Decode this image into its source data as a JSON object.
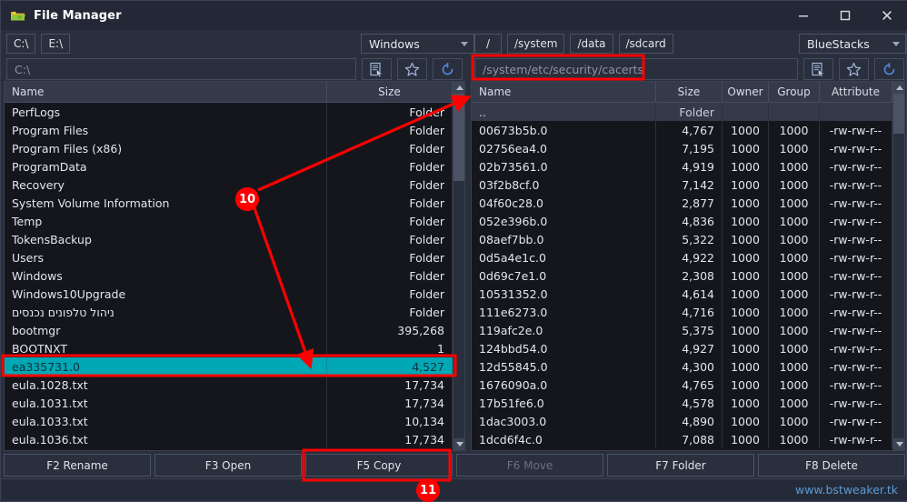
{
  "window": {
    "title": "File Manager",
    "icon": "app-folder-icon",
    "minimize": "–",
    "maximize": "□",
    "close": "×"
  },
  "left_panel": {
    "shortcuts": [
      "C:\\",
      "E:\\"
    ],
    "drive_select": {
      "value": "Windows"
    },
    "path": {
      "value": "C:\\",
      "placeholder": "C:\\"
    },
    "toolbar_icons": [
      "select-list-icon",
      "favorite-star-icon",
      "refresh-icon"
    ],
    "columns": [
      "Name",
      "Size"
    ],
    "rows": [
      {
        "name": "PerfLogs",
        "size": "Folder"
      },
      {
        "name": "Program Files",
        "size": "Folder"
      },
      {
        "name": "Program Files (x86)",
        "size": "Folder"
      },
      {
        "name": "ProgramData",
        "size": "Folder"
      },
      {
        "name": "Recovery",
        "size": "Folder"
      },
      {
        "name": "System Volume Information",
        "size": "Folder"
      },
      {
        "name": "Temp",
        "size": "Folder"
      },
      {
        "name": "TokensBackup",
        "size": "Folder"
      },
      {
        "name": "Users",
        "size": "Folder"
      },
      {
        "name": "Windows",
        "size": "Folder"
      },
      {
        "name": "Windows10Upgrade",
        "size": "Folder"
      },
      {
        "name": "ניהול טלפונים נכנסים",
        "size": "Folder"
      },
      {
        "name": "bootmgr",
        "size": "395,268"
      },
      {
        "name": "BOOTNXT",
        "size": "1"
      },
      {
        "name": "ea335731.0",
        "size": "4,527",
        "selected": true
      },
      {
        "name": "eula.1028.txt",
        "size": "17,734"
      },
      {
        "name": "eula.1031.txt",
        "size": "17,734"
      },
      {
        "name": "eula.1033.txt",
        "size": "10,134"
      },
      {
        "name": "eula.1036.txt",
        "size": "17,734"
      }
    ]
  },
  "right_panel": {
    "shortcuts": [
      "/",
      "/system",
      "/data",
      "/sdcard"
    ],
    "device_select": {
      "value": "BlueStacks"
    },
    "path": {
      "value": "/system/etc/security/cacerts",
      "placeholder": "/system/etc/security/cacerts"
    },
    "toolbar_icons": [
      "select-list-icon",
      "favorite-star-icon",
      "refresh-icon"
    ],
    "columns": [
      "Name",
      "Size",
      "Owner",
      "Group",
      "Attribute"
    ],
    "rows": [
      {
        "name": "..",
        "size": "Folder",
        "owner": "",
        "group": "",
        "attribute": ""
      },
      {
        "name": "00673b5b.0",
        "size": "4,767",
        "owner": "1000",
        "group": "1000",
        "attribute": "-rw-rw-r--"
      },
      {
        "name": "02756ea4.0",
        "size": "7,195",
        "owner": "1000",
        "group": "1000",
        "attribute": "-rw-rw-r--"
      },
      {
        "name": "02b73561.0",
        "size": "4,919",
        "owner": "1000",
        "group": "1000",
        "attribute": "-rw-rw-r--"
      },
      {
        "name": "03f2b8cf.0",
        "size": "7,142",
        "owner": "1000",
        "group": "1000",
        "attribute": "-rw-rw-r--"
      },
      {
        "name": "04f60c28.0",
        "size": "2,877",
        "owner": "1000",
        "group": "1000",
        "attribute": "-rw-rw-r--"
      },
      {
        "name": "052e396b.0",
        "size": "4,836",
        "owner": "1000",
        "group": "1000",
        "attribute": "-rw-rw-r--"
      },
      {
        "name": "08aef7bb.0",
        "size": "5,322",
        "owner": "1000",
        "group": "1000",
        "attribute": "-rw-rw-r--"
      },
      {
        "name": "0d5a4e1c.0",
        "size": "4,922",
        "owner": "1000",
        "group": "1000",
        "attribute": "-rw-rw-r--"
      },
      {
        "name": "0d69c7e1.0",
        "size": "2,308",
        "owner": "1000",
        "group": "1000",
        "attribute": "-rw-rw-r--"
      },
      {
        "name": "10531352.0",
        "size": "4,614",
        "owner": "1000",
        "group": "1000",
        "attribute": "-rw-rw-r--"
      },
      {
        "name": "111e6273.0",
        "size": "4,716",
        "owner": "1000",
        "group": "1000",
        "attribute": "-rw-rw-r--"
      },
      {
        "name": "119afc2e.0",
        "size": "5,375",
        "owner": "1000",
        "group": "1000",
        "attribute": "-rw-rw-r--"
      },
      {
        "name": "124bbd54.0",
        "size": "4,927",
        "owner": "1000",
        "group": "1000",
        "attribute": "-rw-rw-r--"
      },
      {
        "name": "12d55845.0",
        "size": "4,300",
        "owner": "1000",
        "group": "1000",
        "attribute": "-rw-rw-r--"
      },
      {
        "name": "1676090a.0",
        "size": "4,765",
        "owner": "1000",
        "group": "1000",
        "attribute": "-rw-rw-r--"
      },
      {
        "name": "17b51fe6.0",
        "size": "4,578",
        "owner": "1000",
        "group": "1000",
        "attribute": "-rw-rw-r--"
      },
      {
        "name": "1dac3003.0",
        "size": "4,890",
        "owner": "1000",
        "group": "1000",
        "attribute": "-rw-rw-r--"
      },
      {
        "name": "1dcd6f4c.0",
        "size": "7,088",
        "owner": "1000",
        "group": "1000",
        "attribute": "-rw-rw-r--"
      }
    ]
  },
  "function_bar": [
    {
      "label": "F2 Rename",
      "disabled": false
    },
    {
      "label": "F3 Open",
      "disabled": false
    },
    {
      "label": "F5 Copy",
      "disabled": false,
      "highlighted": true
    },
    {
      "label": "F6 Move",
      "disabled": true
    },
    {
      "label": "F7 Folder",
      "disabled": false
    },
    {
      "label": "F8 Delete",
      "disabled": false
    }
  ],
  "status_bar": {
    "link": "www.bstweaker.tk"
  },
  "annotations": {
    "step_10": "10",
    "step_11": "11",
    "accent_color": "#ff0000",
    "selection_color": "#00a7b5"
  }
}
